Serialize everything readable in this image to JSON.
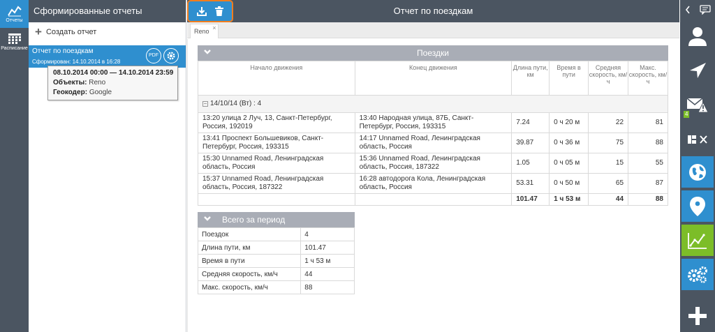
{
  "sidebar": {
    "items": [
      {
        "label": "Отчеты",
        "icon": "chart-line-icon",
        "active": true
      },
      {
        "label": "Расписание",
        "icon": "calendar-grid-icon",
        "active": false
      }
    ]
  },
  "reports_panel": {
    "title": "Сформированные отчеты",
    "create_label": "Создать отчет",
    "report": {
      "name": "Отчет по поездкам",
      "generated": "Сформирован: 14.10.2014 в 16:28",
      "pdf_label": "PDF"
    },
    "tooltip": {
      "period": "08.10.2014 00:00 — 14.10.2014 23:59",
      "objects_label": "Объекты:",
      "objects_value": "Reno",
      "geocoder_label": "Геокодер:",
      "geocoder_value": "Google"
    }
  },
  "main": {
    "title": "Отчет по поездкам",
    "tab": "Reno",
    "tab_close": "×",
    "trips_section": {
      "title": "Поездки",
      "columns": [
        "Начало движения",
        "Конец движения",
        "Длина пути, км",
        "Время в пути",
        "Средняя скорость, км/ч",
        "Макс. скорость, км/ч"
      ],
      "group": "14/10/14 (Вт) : 4",
      "rows": [
        {
          "start": "13:20 улица 2 Луч, 13, Санкт-Петербург, Россия, 192019",
          "end": "13:40 Народная улица, 87Б, Санкт-Петербург, Россия, 193315",
          "dist": "7.24",
          "time": "0 ч 20 м",
          "avg": "22",
          "max": "81"
        },
        {
          "start": "13:41 Проспект Большевиков, Санкт-Петербург, Россия, 193315",
          "end": "14:17 Unnamed Road, Ленинградская область, Россия",
          "dist": "39.87",
          "time": "0 ч 36 м",
          "avg": "75",
          "max": "88"
        },
        {
          "start": "15:30 Unnamed Road, Ленинградская область, Россия",
          "end": "15:36 Unnamed Road, Ленинградская область, Россия, 187322",
          "dist": "1.05",
          "time": "0 ч 05 м",
          "avg": "15",
          "max": "55"
        },
        {
          "start": "15:37 Unnamed Road, Ленинградская область, Россия, 187322",
          "end": "16:28 автодорога Кола, Ленинградская область, Россия",
          "dist": "53.31",
          "time": "0 ч 50 м",
          "avg": "65",
          "max": "87"
        }
      ],
      "total": {
        "dist": "101.47",
        "time": "1 ч 53 м",
        "avg": "44",
        "max": "88"
      }
    },
    "summary_section": {
      "title": "Всего за период",
      "rows": [
        {
          "label": "Поездок",
          "value": "4"
        },
        {
          "label": "Длина пути, км",
          "value": "101.47"
        },
        {
          "label": "Время в пути",
          "value": "1 ч 53 м"
        },
        {
          "label": "Средняя скорость, км/ч",
          "value": "44"
        },
        {
          "label": "Макс. скорость, км/ч",
          "value": "88"
        }
      ]
    }
  },
  "right_bar": {
    "notification_badge": "4",
    "buttons": [
      "user-icon",
      "navigation-arrow-icon",
      "mail-alert-icon",
      "layout-icon",
      "globe-icon",
      "map-pin-icon",
      "chart-icon",
      "gears-icon",
      "plus-icon"
    ]
  },
  "colors": {
    "accent": "#2f8fcf",
    "highlight": "#f07d1e",
    "header": "#4b5561",
    "green": "#7cbd28"
  }
}
